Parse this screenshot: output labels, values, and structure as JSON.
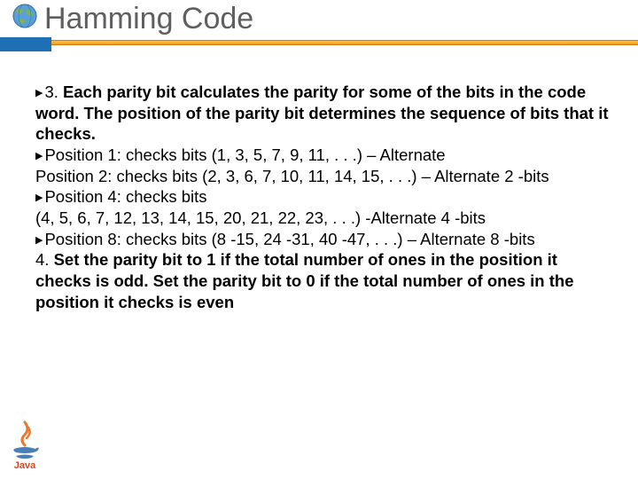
{
  "title": "Hamming Code",
  "b1_lead": "3.",
  "b1_bold": " Each parity bit calculates the parity for some of the bits in the code word. The position of the parity bit determines the sequence of bits that it checks.",
  "b2_a": "Position 1: checks bits (1, 3, 5, 7, 9, 11, . . .) – Alternate",
  "b2_b": "Position 2: checks  bits (2, 3, 6, 7, 10, 11, 14, 15, . . .) – Alternate 2 -bits",
  "b3_a": "Position 4: checks bits",
  "b3_b": "(4, 5, 6, 7, 12, 13, 14, 15, 20, 21, 22, 23, . . .) -Alternate 4 -bits",
  "b4": "Position 8: checks bits (8 -15, 24 -31, 40 -47, . . .) – Alternate 8 -bits",
  "b5_lead": " 4. ",
  "b5_bold": "Set the parity bit to 1 if the total number of ones in the position it checks is odd. Set the parity bit to 0 if the total number of ones in the position it checks is even"
}
